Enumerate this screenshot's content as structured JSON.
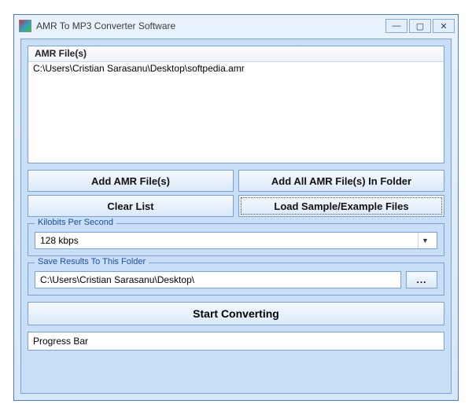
{
  "window": {
    "title": "AMR To MP3 Converter Software",
    "minimize": "—",
    "maximize": "▢",
    "close": "✕"
  },
  "filelist": {
    "header": "AMR File(s)",
    "rows": [
      "C:\\Users\\Cristian Sarasanu\\Desktop\\softpedia.amr"
    ]
  },
  "buttons": {
    "add": "Add AMR File(s)",
    "addFolder": "Add All AMR File(s) In Folder",
    "clear": "Clear List",
    "loadSample": "Load Sample/Example Files",
    "start": "Start Converting",
    "browse": "..."
  },
  "kilobits": {
    "legend": "Kilobits Per Second",
    "value": "128 kbps"
  },
  "saveFolder": {
    "legend": "Save Results To This Folder",
    "value": "C:\\Users\\Cristian Sarasanu\\Desktop\\"
  },
  "progress": {
    "label": "Progress Bar"
  }
}
